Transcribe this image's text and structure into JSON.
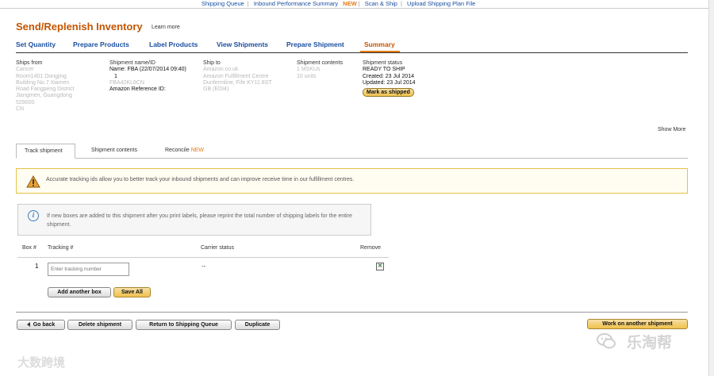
{
  "top_nav": {
    "shipping_queue": "Shipping Queue",
    "inbound_performance": "Inbound Performance Summary",
    "new_badge": "NEW",
    "scan_ship": "Scan & Ship",
    "upload_plan": "Upload Shipping Plan File"
  },
  "page": {
    "title": "Send/Replenish Inventory",
    "learn_more": "Learn more"
  },
  "workflow_tabs": [
    {
      "label": "Set Quantity"
    },
    {
      "label": "Prepare Products"
    },
    {
      "label": "Label Products"
    },
    {
      "label": "View Shipments"
    },
    {
      "label": "Prepare Shipment"
    },
    {
      "label": "Summary"
    }
  ],
  "active_tab": "Summary",
  "shipment_info": {
    "ships_from": {
      "label": "Ships from",
      "lines": [
        "Cancer",
        "Room1401 Dongjing",
        "Building No.7 Xiamen",
        "Road Fangpeng District",
        "Jiangmen, Guangdong",
        "529000",
        "CN"
      ]
    },
    "shipment_name": {
      "label": "Shipment name/ID",
      "name": "Name: FBA (22/07/2014 09:40)",
      "id_line": "1",
      "fba_id": "FBA42KL8CN",
      "reference": "Amazon Reference ID:"
    },
    "ship_to": {
      "label": "Ship to",
      "lines": [
        "Amazon.co.uk",
        "Amazon Fulfillment Centre",
        "Dunfermline, Fife KY11 8ST",
        "GB (EDI4)"
      ]
    },
    "contents": {
      "label": "Shipment contents",
      "lines": [
        "1 MSKUs",
        "10 units"
      ]
    },
    "status": {
      "label": "Shipment status",
      "state": "READY TO SHIP",
      "created": "Created: 23 Jul 2014",
      "updated": "Updated: 23 Jul 2014",
      "mark_shipped": "Mark as shipped"
    }
  },
  "show_more": "Show More",
  "sub_tabs": [
    {
      "label": "Track shipment"
    },
    {
      "label": "Shipment contents"
    },
    {
      "label": "Reconcile",
      "badge": "NEW"
    }
  ],
  "alert": {
    "text": "Accurate tracking ids allow you to better track your inbound shipments and can improve receive time in our fulfillment centres."
  },
  "notice": {
    "text": "If new boxes are added to this shipment after you print labels, please reprint the total number of shipping labels for the entire shipment."
  },
  "table": {
    "headers": {
      "box": "Box #",
      "tracking": "Tracking #",
      "carrier": "Carrier status",
      "remove": "Remove"
    },
    "rows": [
      {
        "box": "1",
        "tracking_placeholder": "Enter tracking number",
        "carrier_status": "--"
      }
    ]
  },
  "actions": {
    "add_box": "Add another box",
    "save_all": "Save All",
    "go_back": "Go back",
    "delete_shipment": "Delete shipment",
    "return_queue": "Return to Shipping Queue",
    "duplicate": "Duplicate",
    "work_another": "Work on another shipment"
  },
  "watermarks": {
    "left": "大数跨境",
    "right": "乐淘帮"
  }
}
